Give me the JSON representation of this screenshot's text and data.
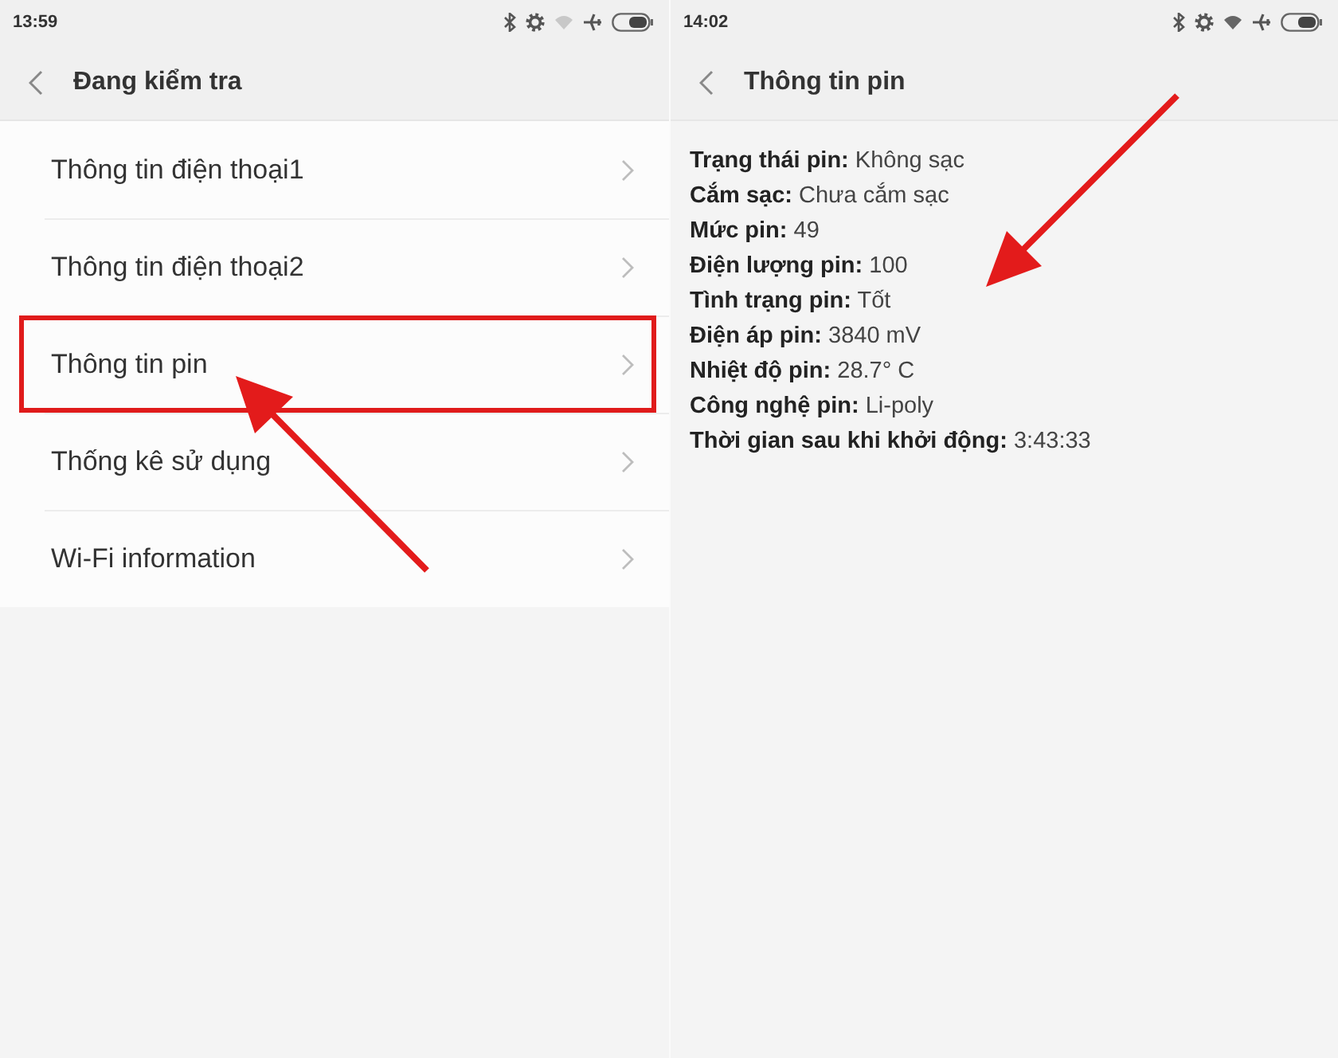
{
  "screens": [
    {
      "kind": "menu",
      "status_bar": {
        "time": "13:59"
      },
      "header": {
        "title": "Đang kiểm tra"
      },
      "items": [
        {
          "label": "Thông tin điện thoại1",
          "highlighted": false
        },
        {
          "label": "Thông tin điện thoại2",
          "highlighted": false
        },
        {
          "label": "Thông tin pin",
          "highlighted": true
        },
        {
          "label": "Thống kê sử dụng",
          "highlighted": false
        },
        {
          "label": "Wi-Fi information",
          "highlighted": false
        }
      ]
    },
    {
      "kind": "details",
      "status_bar": {
        "time": "14:02"
      },
      "header": {
        "title": "Thông tin pin"
      },
      "rows": [
        {
          "label": "Trạng thái pin:",
          "value": "Không sạc"
        },
        {
          "label": "Cắm sạc:",
          "value": "Chưa cắm sạc"
        },
        {
          "label": "Mức pin:",
          "value": "49"
        },
        {
          "label": "Điện lượng pin:",
          "value": "100"
        },
        {
          "label": "Tình trạng pin:",
          "value": "Tốt"
        },
        {
          "label": "Điện áp pin:",
          "value": "3840 mV"
        },
        {
          "label": "Nhiệt độ pin:",
          "value": "28.7° C"
        },
        {
          "label": "Công nghệ pin:",
          "value": "Li-poly"
        },
        {
          "label": "Thời gian sau khi khởi động:",
          "value": "3:43:33"
        }
      ]
    }
  ]
}
